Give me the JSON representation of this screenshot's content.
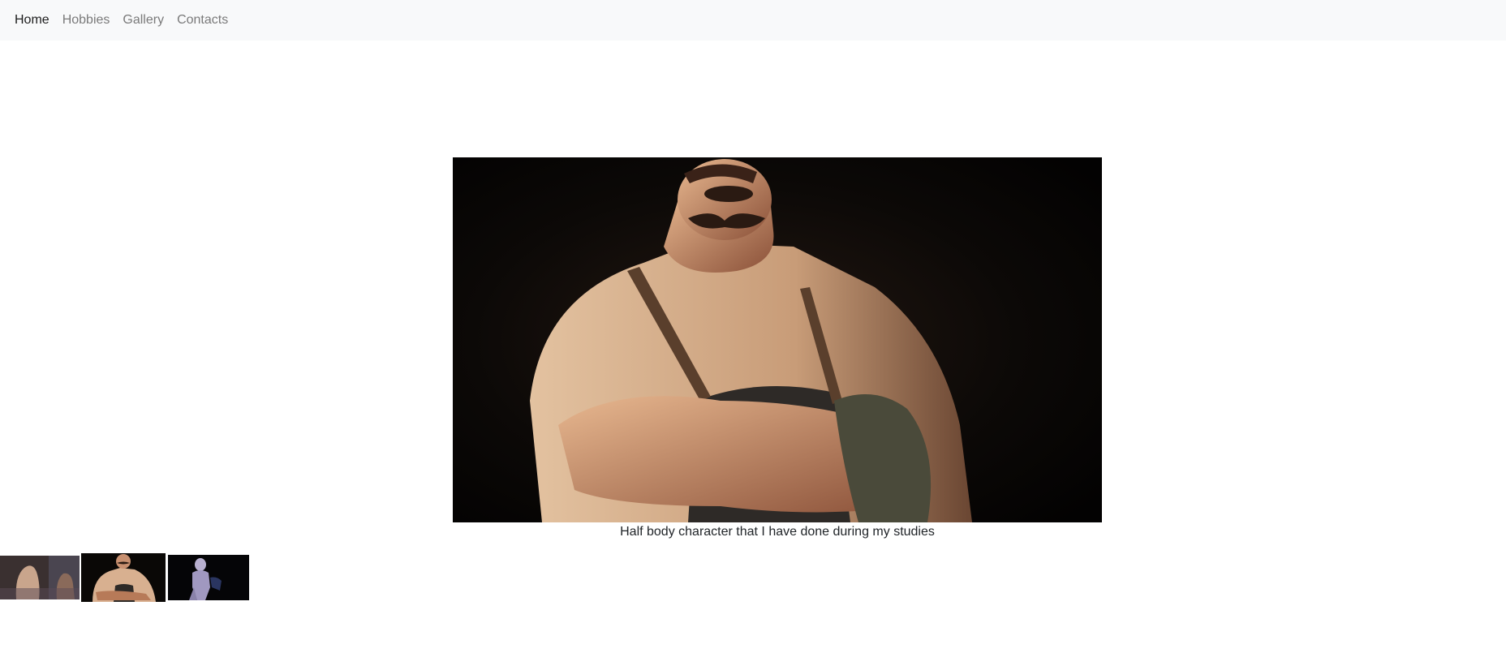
{
  "nav": {
    "items": [
      {
        "label": "Home",
        "active": true
      },
      {
        "label": "Hobbies",
        "active": false
      },
      {
        "label": "Gallery",
        "active": false
      },
      {
        "label": "Contacts",
        "active": false
      }
    ]
  },
  "gallery": {
    "caption": "Half body character that I have done during my studies",
    "selected_index": 1,
    "thumbnails": [
      {
        "icon": "character-render-image"
      },
      {
        "icon": "character-render-image"
      },
      {
        "icon": "character-render-image"
      }
    ]
  },
  "colors": {
    "navbar_bg": "#f8f9fa",
    "nav_active": "#1d1d1d",
    "nav_inactive": "#7a7a7a",
    "text": "#212529"
  }
}
